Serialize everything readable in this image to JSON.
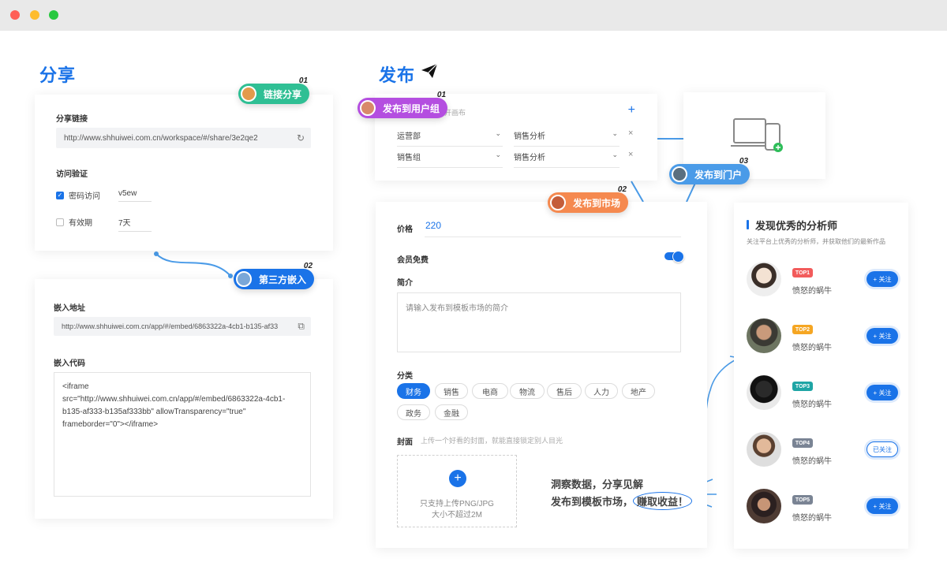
{
  "share": {
    "title": "分享",
    "link_tag": {
      "label": "链接分享",
      "num": "01"
    },
    "link_label": "分享链接",
    "link_url": "http://www.shhuiwei.com.cn/workspace/#/share/3e2qe2",
    "verify_label": "访问验证",
    "password_label": "密码访问",
    "password_value": "v5ew",
    "validity_label": "有效期",
    "validity_value": "7天",
    "embed_tag": {
      "label": "第三方嵌入",
      "num": "02"
    },
    "embed_addr_label": "嵌入地址",
    "embed_addr": "http://www.shhuiwei.com.cn/app/#/embed/6863322a-4cb1-b135-af33",
    "embed_code_label": "嵌入代码",
    "embed_code": "<iframe\nsrc=\"http://www.shhuiwei.com.cn/app/#/embed/6863322a-4cb1-\nb135-af333-b135af333bb\" allowTransparency=\"true\"\nframeborder=\"0\"></iframe>"
  },
  "publish": {
    "title": "发布",
    "group_tag": {
      "label": "发布到用户组",
      "num": "01"
    },
    "group_hint": "开画布",
    "rows": [
      {
        "group": "运营部",
        "view": "销售分析"
      },
      {
        "group": "销售组",
        "view": "销售分析"
      }
    ],
    "portal_tag": {
      "label": "发布到门户",
      "num": "03"
    },
    "market_tag": {
      "label": "发布到市场",
      "num": "02"
    },
    "price_label": "价格",
    "price_value": "220",
    "member_label": "会员免费",
    "intro_label": "简介",
    "intro_placeholder": "请输入发布到模板市场的简介",
    "category_label": "分类",
    "categories": [
      "财务",
      "销售",
      "电商",
      "物流",
      "售后",
      "人力",
      "地产",
      "政务",
      "金融"
    ],
    "cover_label": "封面",
    "cover_hint": "上传一个好看的封面，就能直接锁定别人目光",
    "upload_line1": "只支持上传PNG/JPG",
    "upload_line2": "大小不超过2M"
  },
  "slogan": {
    "line1": "洞察数据，分享见解",
    "line2": "发布到模板市场，",
    "highlight": "赚取收益！"
  },
  "analysts": {
    "title": "发现优秀的分析师",
    "subtitle": "关注平台上优秀的分析师，并获取他们的最新作品",
    "items": [
      {
        "rank": "TOP1",
        "name": "愤怒的蜗牛",
        "follow": "+ 关注",
        "rank_color": "#f25b5b"
      },
      {
        "rank": "TOP2",
        "name": "愤怒的蜗牛",
        "follow": "+ 关注",
        "rank_color": "#f5a623"
      },
      {
        "rank": "TOP3",
        "name": "愤怒的蜗牛",
        "follow": "+ 关注",
        "rank_color": "#1fa5a5"
      },
      {
        "rank": "TOP4",
        "name": "愤怒的蜗牛",
        "follow": "已关注",
        "rank_color": "#7a8494"
      },
      {
        "rank": "TOP5",
        "name": "愤怒的蜗牛",
        "follow": "+ 关注",
        "rank_color": "#7a8494"
      }
    ]
  },
  "colors": {
    "accent": "#1a73e8",
    "green_tag": "#2fbf94",
    "purple_tag": "#b44ee0",
    "orange_tag": "#f5894f",
    "blue_tag": "#1a73e8"
  }
}
